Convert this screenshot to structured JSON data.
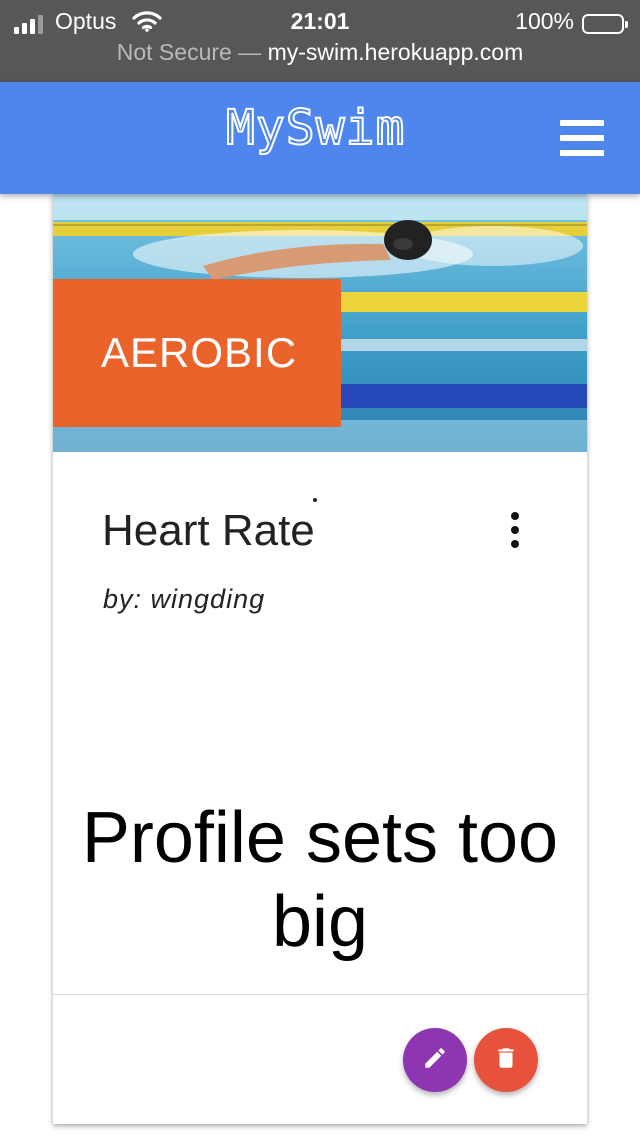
{
  "status_bar": {
    "carrier": "Optus",
    "time": "21:01",
    "battery": "100%",
    "signal_icon": "cellular-signal-icon",
    "wifi_icon": "wifi-icon",
    "battery_icon": "battery-icon"
  },
  "address_bar": {
    "security": "Not Secure",
    "separator": " — ",
    "domain": "my-swim.herokuapp.com"
  },
  "app_bar": {
    "title": "MySwim",
    "menu_icon": "hamburger-menu-icon"
  },
  "card": {
    "category": "AEROBIC",
    "title": "Heart Rate",
    "author": "by: wingding",
    "caption": "Profile sets too big",
    "more_icon": "more-vertical-icon",
    "edit_icon": "pencil-icon",
    "delete_icon": "trash-icon"
  },
  "colors": {
    "app_bar": "#4f86ee",
    "status_bar": "#575757",
    "category_banner": "#e9632b",
    "edit_fab": "#8e35b1",
    "delete_fab": "#e8523c"
  }
}
